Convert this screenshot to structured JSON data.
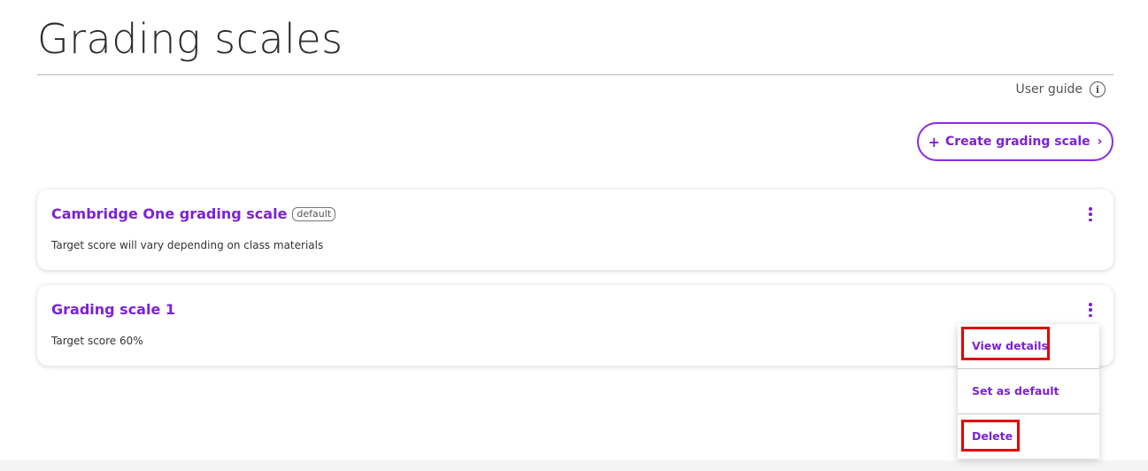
{
  "header": {
    "title": "Grading scales",
    "user_guide_label": "User guide",
    "info_icon": "i"
  },
  "toolbar": {
    "create_label": "Create grading scale",
    "plus_icon": "+",
    "chevron_icon": "›"
  },
  "scales": [
    {
      "name": "Cambridge One grading scale",
      "badge": "default",
      "description": "Target score will vary depending on class materials"
    },
    {
      "name": "Grading scale 1",
      "description": "Target score 60%"
    }
  ],
  "context_menu": {
    "items": [
      {
        "label": "View details"
      },
      {
        "label": "Set as default"
      },
      {
        "label": "Delete"
      }
    ]
  },
  "colors": {
    "accent": "#7b22d6",
    "highlight": "#e00000"
  }
}
